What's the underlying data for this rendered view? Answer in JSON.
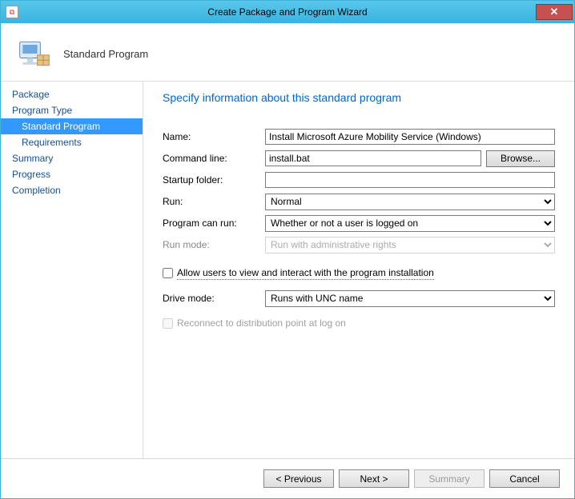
{
  "window": {
    "title": "Create Package and Program Wizard"
  },
  "header": {
    "title": "Standard Program"
  },
  "nav": {
    "items": [
      {
        "label": "Package",
        "indent": 0,
        "selected": false
      },
      {
        "label": "Program Type",
        "indent": 0,
        "selected": false
      },
      {
        "label": "Standard Program",
        "indent": 1,
        "selected": true
      },
      {
        "label": "Requirements",
        "indent": 1,
        "selected": false
      },
      {
        "label": "Summary",
        "indent": 0,
        "selected": false
      },
      {
        "label": "Progress",
        "indent": 0,
        "selected": false
      },
      {
        "label": "Completion",
        "indent": 0,
        "selected": false
      }
    ]
  },
  "content": {
    "heading": "Specify information about this standard program",
    "labels": {
      "name": "Name:",
      "commandLine": "Command line:",
      "browse": "Browse...",
      "startupFolder": "Startup folder:",
      "run": "Run:",
      "programCanRun": "Program can run:",
      "runMode": "Run mode:",
      "allowInteract": "Allow users to view and interact with the program installation",
      "driveMode": "Drive mode:",
      "reconnect": "Reconnect to distribution point at log on"
    },
    "values": {
      "name": "Install Microsoft Azure Mobility Service (Windows)",
      "commandLine": "install.bat",
      "startupFolder": "",
      "run": "Normal",
      "programCanRun": "Whether or not a user is logged on",
      "runMode": "Run with administrative rights",
      "driveMode": "Runs with UNC name"
    }
  },
  "footer": {
    "previous": "< Previous",
    "next": "Next >",
    "summary": "Summary",
    "cancel": "Cancel"
  }
}
